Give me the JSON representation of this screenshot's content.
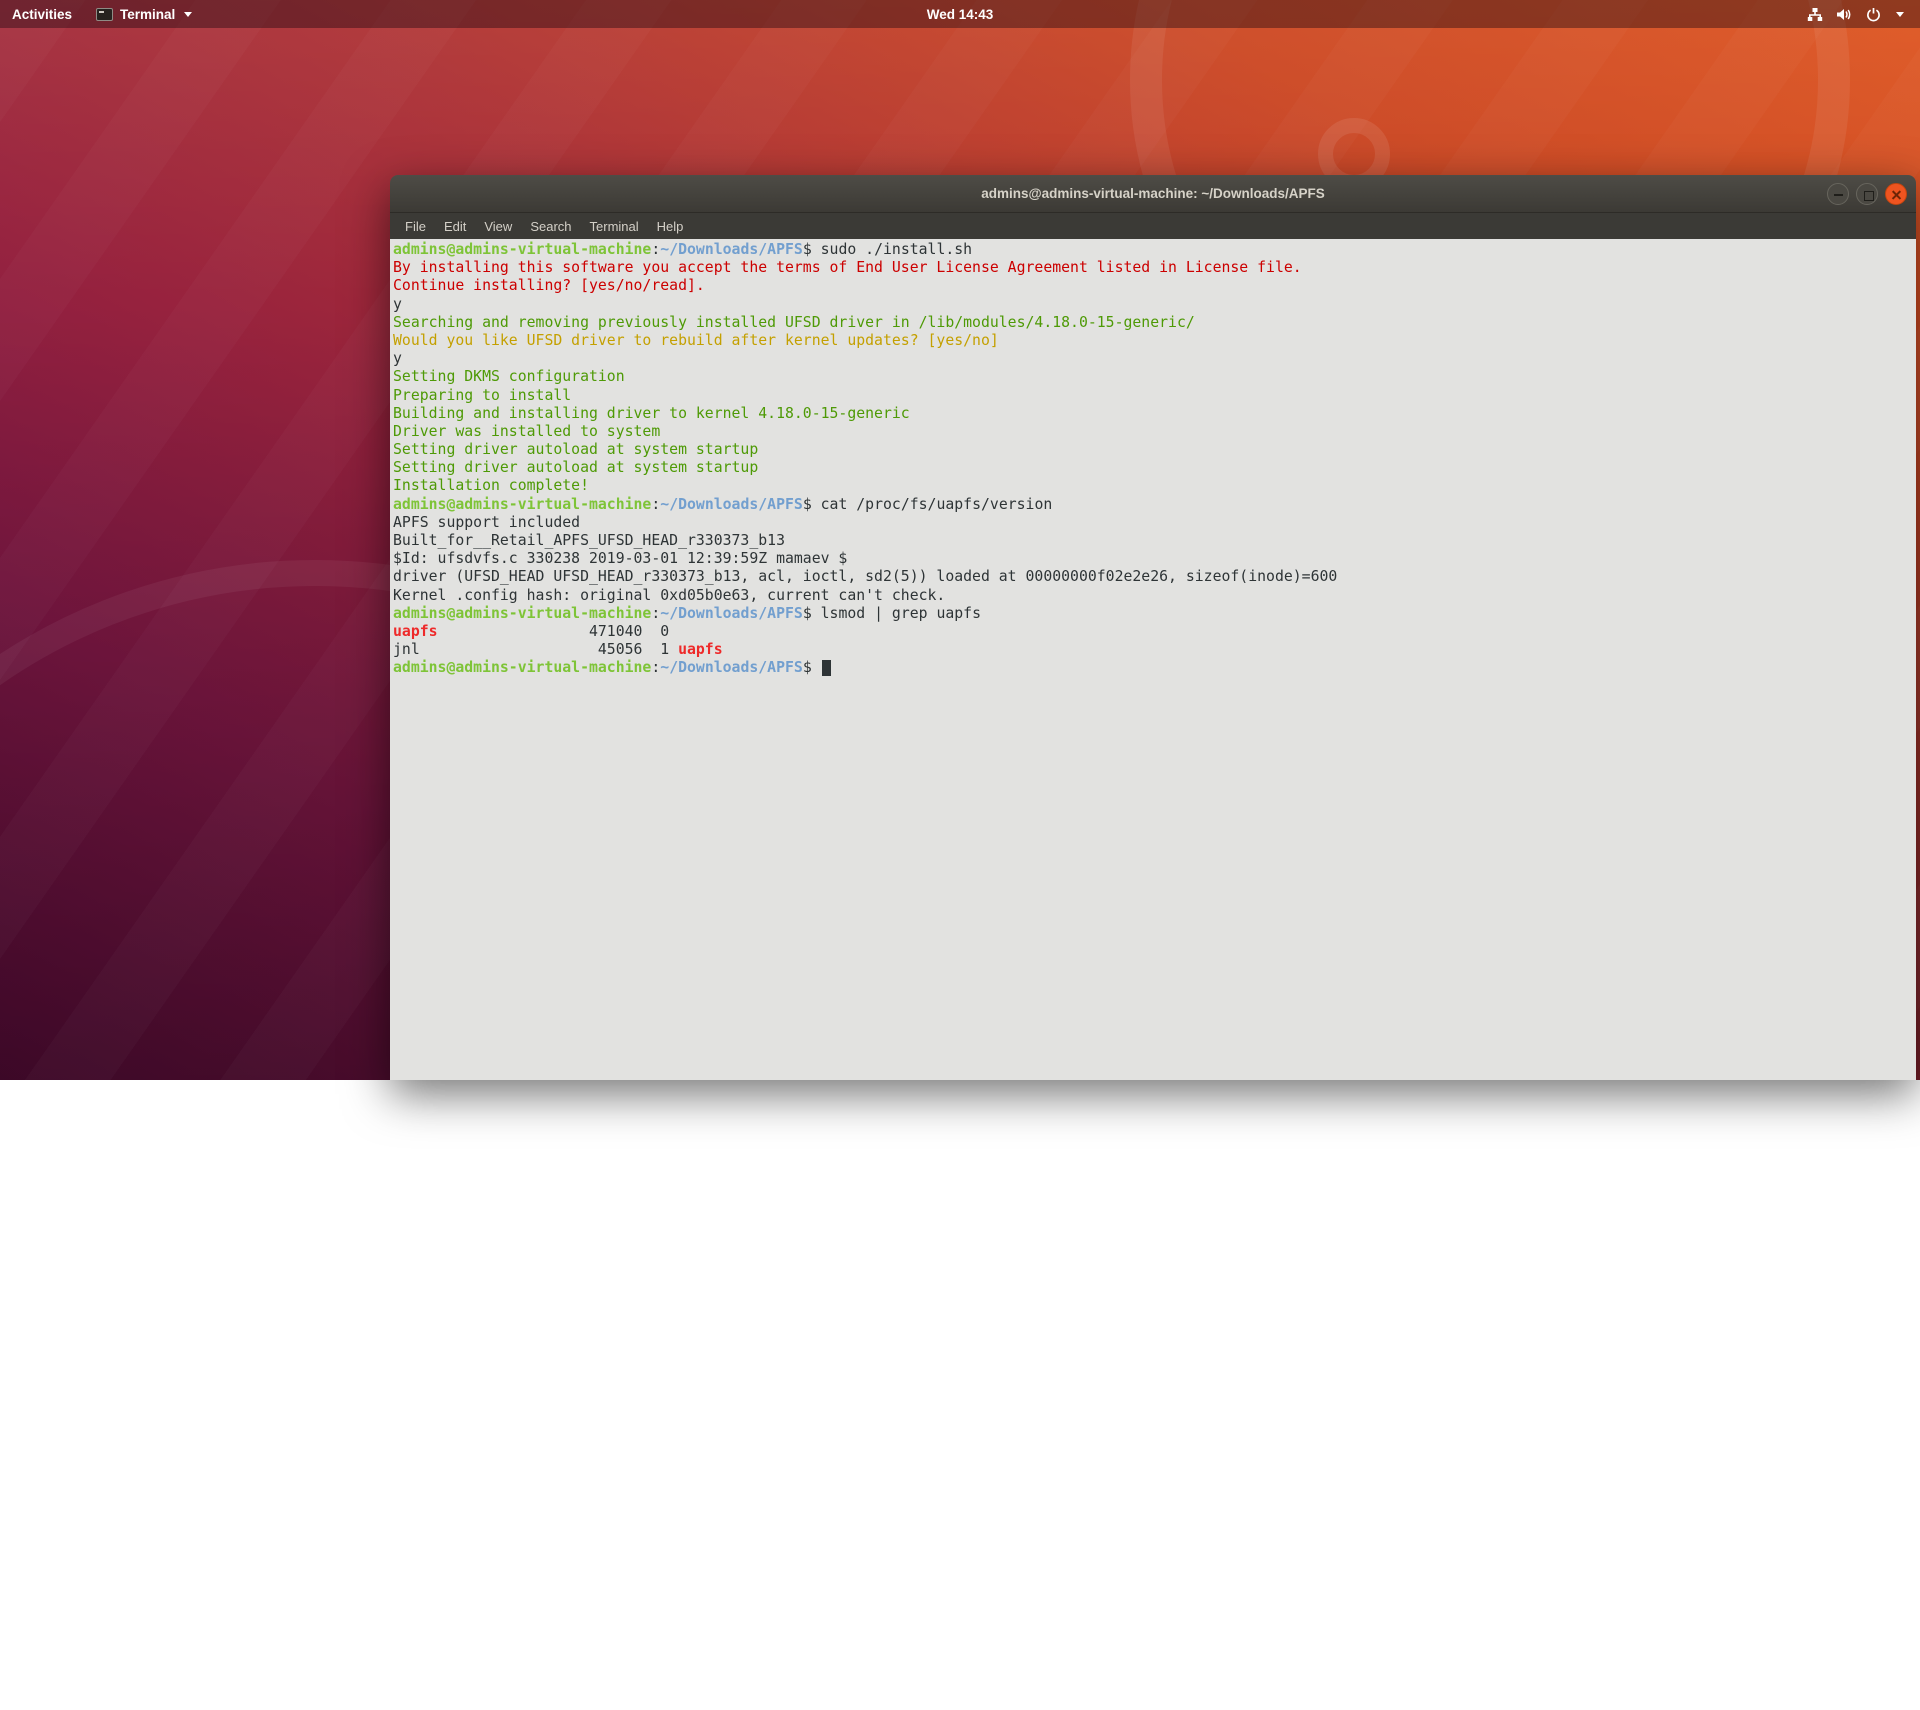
{
  "desktop": {
    "top_bar": {
      "activities_label": "Activities",
      "app_menu": {
        "label": "Terminal",
        "icon": "terminal-icon",
        "caret": "chevron-down-icon"
      },
      "clock": "Wed 14:43",
      "tray_icons": [
        "network-icon",
        "volume-icon",
        "power-icon",
        "chevron-down-icon"
      ]
    },
    "wallpaper_colors": {
      "top_right": "#de5520",
      "mid": "#ad3134",
      "bottom_left": "#560c38"
    }
  },
  "window": {
    "title": "admins@admins-virtual-machine: ~/Downloads/APFS",
    "controls": [
      "minimize-icon",
      "maximize-icon",
      "close-icon"
    ],
    "close_color": "#ef5420",
    "menu": [
      "File",
      "Edit",
      "View",
      "Search",
      "Terminal",
      "Help"
    ]
  },
  "terminal": {
    "background": "#e2e2e0",
    "palette": {
      "fg": "#2e3436",
      "red": "#cc0000",
      "brightRed": "#ee2a2a",
      "green": "#4e9a06",
      "brightGreen": "#7ec437",
      "yellow": "#c4a000",
      "blue": "#729fcf"
    },
    "lines": [
      {
        "segs": [
          {
            "t": "admins@admins-virtual-machine",
            "c": "brightGreen",
            "b": true
          },
          {
            "t": ":",
            "c": "fg"
          },
          {
            "t": "~/Downloads/APFS",
            "c": "blue",
            "b": true
          },
          {
            "t": "$ sudo ./install.sh",
            "c": "fg"
          }
        ]
      },
      {
        "segs": [
          {
            "t": "By installing this software you accept the terms of End User License Agreement listed in License file.",
            "c": "red"
          }
        ]
      },
      {
        "segs": [
          {
            "t": "Continue installing? [yes/no/read].",
            "c": "red"
          }
        ]
      },
      {
        "segs": [
          {
            "t": "y",
            "c": "fg"
          }
        ]
      },
      {
        "segs": [
          {
            "t": "Searching and removing previously installed UFSD driver in /lib/modules/4.18.0-15-generic/",
            "c": "green"
          }
        ]
      },
      {
        "segs": [
          {
            "t": "Would you like UFSD driver to rebuild after kernel updates? [yes/no]",
            "c": "yellow"
          }
        ]
      },
      {
        "segs": [
          {
            "t": "y",
            "c": "fg"
          }
        ]
      },
      {
        "segs": [
          {
            "t": "Setting DKMS configuration",
            "c": "green"
          }
        ]
      },
      {
        "segs": [
          {
            "t": "Preparing to install",
            "c": "green"
          }
        ]
      },
      {
        "segs": [
          {
            "t": "Building and installing driver to kernel 4.18.0-15-generic",
            "c": "green"
          }
        ]
      },
      {
        "segs": [
          {
            "t": "Driver was installed to system",
            "c": "green"
          }
        ]
      },
      {
        "segs": [
          {
            "t": "Setting driver autoload at system startup",
            "c": "green"
          }
        ]
      },
      {
        "segs": [
          {
            "t": "Setting driver autoload at system startup",
            "c": "green"
          }
        ]
      },
      {
        "segs": [
          {
            "t": "Installation complete!",
            "c": "green"
          }
        ]
      },
      {
        "segs": [
          {
            "t": "admins@admins-virtual-machine",
            "c": "brightGreen",
            "b": true
          },
          {
            "t": ":",
            "c": "fg"
          },
          {
            "t": "~/Downloads/APFS",
            "c": "blue",
            "b": true
          },
          {
            "t": "$ cat /proc/fs/uapfs/version",
            "c": "fg"
          }
        ]
      },
      {
        "segs": [
          {
            "t": "APFS support included",
            "c": "fg"
          }
        ]
      },
      {
        "segs": [
          {
            "t": "Built_for__Retail_APFS_UFSD_HEAD_r330373_b13",
            "c": "fg"
          }
        ]
      },
      {
        "segs": [
          {
            "t": "$Id: ufsdvfs.c 330238 2019-03-01 12:39:59Z mamaev $",
            "c": "fg"
          }
        ]
      },
      {
        "segs": [
          {
            "t": "driver (UFSD_HEAD UFSD_HEAD_r330373_b13, acl, ioctl, sd2(5)) loaded at 00000000f02e2e26, sizeof(inode)=600",
            "c": "fg"
          }
        ]
      },
      {
        "segs": [
          {
            "t": "Kernel .config hash: original 0xd05b0e63, current can't check.",
            "c": "fg"
          }
        ]
      },
      {
        "segs": [
          {
            "t": "admins@admins-virtual-machine",
            "c": "brightGreen",
            "b": true
          },
          {
            "t": ":",
            "c": "fg"
          },
          {
            "t": "~/Downloads/APFS",
            "c": "blue",
            "b": true
          },
          {
            "t": "$ lsmod | grep uapfs",
            "c": "fg"
          }
        ]
      },
      {
        "segs": [
          {
            "t": "uapfs",
            "c": "brightRed",
            "b": true
          },
          {
            "t": "                 471040  0",
            "c": "fg"
          }
        ]
      },
      {
        "segs": [
          {
            "t": "jnl                    45056  1 ",
            "c": "fg"
          },
          {
            "t": "uapfs",
            "c": "brightRed",
            "b": true
          }
        ]
      },
      {
        "segs": [
          {
            "t": "admins@admins-virtual-machine",
            "c": "brightGreen",
            "b": true
          },
          {
            "t": ":",
            "c": "fg"
          },
          {
            "t": "~/Downloads/APFS",
            "c": "blue",
            "b": true
          },
          {
            "t": "$ ",
            "c": "fg"
          },
          {
            "cursor": true
          }
        ]
      }
    ]
  }
}
